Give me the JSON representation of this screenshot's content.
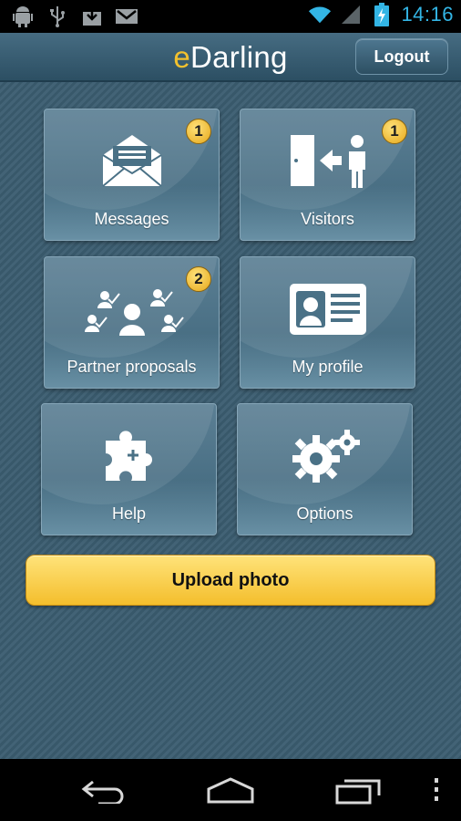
{
  "status_bar": {
    "time": "14:16",
    "icons": [
      "android-debug-icon",
      "usb-icon",
      "download-icon",
      "gmail-icon",
      "wifi-icon",
      "signal-icon",
      "battery-charging-icon"
    ]
  },
  "header": {
    "logo_prefix": "e",
    "logo_rest": "Darling",
    "logout_label": "Logout"
  },
  "tiles": [
    {
      "label": "Messages",
      "icon": "envelope-icon",
      "badge": "1"
    },
    {
      "label": "Visitors",
      "icon": "visitor-door-icon",
      "badge": "1"
    },
    {
      "label": "Partner proposals",
      "icon": "partner-proposals-icon",
      "badge": "2"
    },
    {
      "label": "My profile",
      "icon": "id-card-icon",
      "badge": ""
    },
    {
      "label": "Help",
      "icon": "puzzle-piece-icon",
      "badge": ""
    },
    {
      "label": "Options",
      "icon": "gears-icon",
      "badge": ""
    }
  ],
  "upload_label": "Upload photo",
  "nav": [
    "back-icon",
    "home-icon",
    "recent-apps-icon",
    "overflow-menu-icon"
  ],
  "colors": {
    "accent_blue": "#33b5e5",
    "badge_gold": "#f2c12e",
    "button_yellow": "#f4be2c",
    "panel_bg": "#3b5d70"
  }
}
